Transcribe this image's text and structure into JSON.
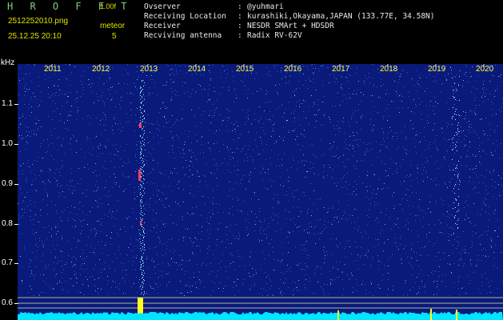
{
  "header": {
    "title": "H R O F F T",
    "version": "1.00f",
    "filename": "2512252010.png",
    "datetime": "25.12.25 20:10",
    "mode_label": "meteor",
    "count": "5"
  },
  "info": [
    {
      "key": "Ovserver",
      "sep": ":",
      "value": "@yuhmari"
    },
    {
      "key": "Receiving Location",
      "sep": ":",
      "value": "kurashiki,Okayama,JAPAN (133.77E, 34.58N)"
    },
    {
      "key": "Receiver",
      "sep": ":",
      "value": "NESDR SMArt + HDSDR"
    },
    {
      "key": "Recviving antenna",
      "sep": ":",
      "value": "Radix RV-62V"
    }
  ],
  "spectrogram": {
    "y_unit": "kHz",
    "y_ticks": [
      "1.1",
      "1.0",
      "0.9",
      "0.8",
      "0.7",
      "0.6"
    ],
    "x_ticks": [
      "2011",
      "2012",
      "2013",
      "2014",
      "2015",
      "2016",
      "2017",
      "2018",
      "2019",
      "2020"
    ],
    "colors": {
      "background": "#0a1a7a",
      "noise": "#2f6dff",
      "bright": "#9ff7ff",
      "baseline": "#00e5ff",
      "highlight": "#ffff20",
      "meteor": "#ff4060"
    }
  }
}
